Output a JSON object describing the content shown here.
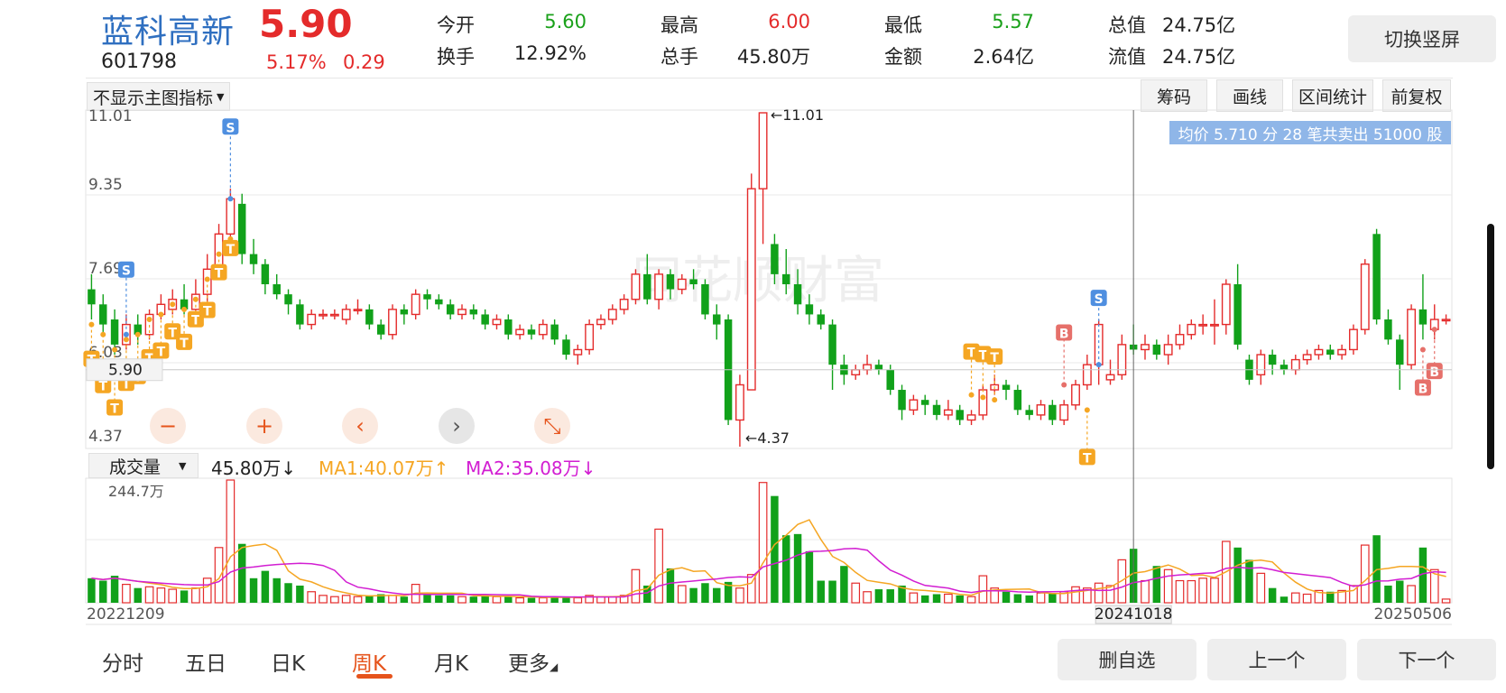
{
  "header": {
    "name": "蓝科高新",
    "price": "5.90",
    "code": "601798",
    "change_pct": "5.17%",
    "change": "0.29",
    "quotes": [
      {
        "label": "今开",
        "value": "5.60",
        "color": "green"
      },
      {
        "label": "最高",
        "value": "6.00",
        "color": "red"
      },
      {
        "label": "最低",
        "value": "5.57",
        "color": "green"
      },
      {
        "label": "总值",
        "value": "24.75亿",
        "color": "dark"
      },
      {
        "label": "换手",
        "value": "12.92%",
        "color": "dark"
      },
      {
        "label": "总手",
        "value": "45.80万",
        "color": "dark"
      },
      {
        "label": "金额",
        "value": "2.64亿",
        "color": "dark"
      },
      {
        "label": "流值",
        "value": "24.75亿",
        "color": "dark"
      }
    ],
    "rotate_button": "切换竖屏"
  },
  "toolbar": {
    "indicator_select": "不显示主图指标",
    "buttons": [
      "筹码",
      "画线",
      "区间统计",
      "前复权"
    ]
  },
  "main_chart": {
    "y_labels": [
      "11.01",
      "9.35",
      "7.69",
      "6.03",
      "4.37"
    ],
    "current_price_label": "5.90",
    "high_marker": "11.01",
    "low_marker": "4.37",
    "watermark": "同花顺财富",
    "tooltip": "均价 5.710 分 28 笔共卖出 51000 股",
    "controls": [
      "zoom-out",
      "zoom-in",
      "pan-left",
      "pan-right",
      "collapse"
    ]
  },
  "volume": {
    "select_label": "成交量",
    "value": "45.80万↓",
    "ma1": "MA1:40.07万↑",
    "ma2": "MA2:35.08万↓",
    "max_label": "244.7万",
    "date_start": "20221209",
    "date_cursor": "20241018",
    "date_end": "20250506"
  },
  "nav": {
    "tabs": [
      "分时",
      "五日",
      "日K",
      "周K",
      "月K",
      "更多"
    ],
    "active": "周K",
    "buttons": [
      "删自选",
      "上一个",
      "下一个"
    ]
  },
  "colors": {
    "up": "#e42b2b",
    "down": "#11a11a",
    "ma1": "#f5a623",
    "ma2": "#d21ed2",
    "accent": "#e6541c",
    "signal": "#f5a623",
    "sell_signal": "#4f8fe0",
    "buy_signal": "#e6706a"
  },
  "chart_data": {
    "type": "candlestick",
    "y_range": [
      4.37,
      11.01
    ],
    "weeks": [
      {
        "o": 7.5,
        "c": 7.2,
        "h": 7.8,
        "l": 6.9,
        "v": 0.2
      },
      {
        "o": 7.2,
        "c": 6.8,
        "h": 7.4,
        "l": 6.6,
        "v": 0.18
      },
      {
        "o": 6.9,
        "c": 6.4,
        "h": 7.1,
        "l": 6.2,
        "v": 0.22
      },
      {
        "o": 6.4,
        "c": 6.8,
        "h": 7.0,
        "l": 6.3,
        "v": 0.15
      },
      {
        "o": 6.8,
        "c": 6.6,
        "h": 7.0,
        "l": 6.4,
        "v": 0.12
      },
      {
        "o": 6.6,
        "c": 7.0,
        "h": 7.1,
        "l": 6.5,
        "v": 0.13
      },
      {
        "o": 7.0,
        "c": 7.2,
        "h": 7.4,
        "l": 6.9,
        "v": 0.12
      },
      {
        "o": 7.1,
        "c": 7.3,
        "h": 7.5,
        "l": 7.0,
        "v": 0.11
      },
      {
        "o": 7.3,
        "c": 7.1,
        "h": 7.6,
        "l": 7.0,
        "v": 0.1
      },
      {
        "o": 7.1,
        "c": 7.4,
        "h": 7.7,
        "l": 7.0,
        "v": 0.12
      },
      {
        "o": 7.4,
        "c": 7.9,
        "h": 8.2,
        "l": 7.2,
        "v": 0.2
      },
      {
        "o": 7.9,
        "c": 8.6,
        "h": 8.8,
        "l": 7.7,
        "v": 0.45
      },
      {
        "o": 8.6,
        "c": 9.3,
        "h": 9.5,
        "l": 8.3,
        "v": 1.0
      },
      {
        "o": 9.2,
        "c": 8.2,
        "h": 9.4,
        "l": 8.0,
        "v": 0.48
      },
      {
        "o": 8.2,
        "c": 8.0,
        "h": 8.5,
        "l": 7.8,
        "v": 0.2
      },
      {
        "o": 8.0,
        "c": 7.6,
        "h": 8.1,
        "l": 7.4,
        "v": 0.26
      },
      {
        "o": 7.6,
        "c": 7.4,
        "h": 7.8,
        "l": 7.3,
        "v": 0.2
      },
      {
        "o": 7.4,
        "c": 7.2,
        "h": 7.5,
        "l": 7.0,
        "v": 0.16
      },
      {
        "o": 7.2,
        "c": 6.8,
        "h": 7.3,
        "l": 6.7,
        "v": 0.14
      },
      {
        "o": 6.8,
        "c": 7.0,
        "h": 7.1,
        "l": 6.7,
        "v": 0.09
      },
      {
        "o": 7.0,
        "c": 7.0,
        "h": 7.1,
        "l": 6.9,
        "v": 0.06
      },
      {
        "o": 7.0,
        "c": 7.0,
        "h": 7.1,
        "l": 6.9,
        "v": 0.05
      },
      {
        "o": 6.9,
        "c": 7.1,
        "h": 7.2,
        "l": 6.8,
        "v": 0.06
      },
      {
        "o": 7.1,
        "c": 7.1,
        "h": 7.3,
        "l": 7.0,
        "v": 0.05
      },
      {
        "o": 7.1,
        "c": 6.8,
        "h": 7.2,
        "l": 6.7,
        "v": 0.06
      },
      {
        "o": 6.8,
        "c": 6.6,
        "h": 6.9,
        "l": 6.5,
        "v": 0.07
      },
      {
        "o": 6.6,
        "c": 7.1,
        "h": 7.2,
        "l": 6.5,
        "v": 0.06
      },
      {
        "o": 7.1,
        "c": 7.0,
        "h": 7.2,
        "l": 6.8,
        "v": 0.05
      },
      {
        "o": 7.0,
        "c": 7.4,
        "h": 7.5,
        "l": 6.9,
        "v": 0.15
      },
      {
        "o": 7.4,
        "c": 7.3,
        "h": 7.5,
        "l": 7.1,
        "v": 0.07
      },
      {
        "o": 7.3,
        "c": 7.2,
        "h": 7.4,
        "l": 7.1,
        "v": 0.06
      },
      {
        "o": 7.2,
        "c": 7.0,
        "h": 7.3,
        "l": 6.9,
        "v": 0.06
      },
      {
        "o": 7.0,
        "c": 7.1,
        "h": 7.2,
        "l": 6.9,
        "v": 0.05
      },
      {
        "o": 7.1,
        "c": 7.0,
        "h": 7.2,
        "l": 6.9,
        "v": 0.05
      },
      {
        "o": 7.0,
        "c": 6.8,
        "h": 7.1,
        "l": 6.7,
        "v": 0.06
      },
      {
        "o": 6.8,
        "c": 6.9,
        "h": 7.0,
        "l": 6.7,
        "v": 0.05
      },
      {
        "o": 6.9,
        "c": 6.6,
        "h": 7.0,
        "l": 6.5,
        "v": 0.05
      },
      {
        "o": 6.6,
        "c": 6.7,
        "h": 6.8,
        "l": 6.5,
        "v": 0.04
      },
      {
        "o": 6.7,
        "c": 6.6,
        "h": 6.8,
        "l": 6.5,
        "v": 0.04
      },
      {
        "o": 6.6,
        "c": 6.8,
        "h": 6.9,
        "l": 6.5,
        "v": 0.04
      },
      {
        "o": 6.8,
        "c": 6.5,
        "h": 6.9,
        "l": 6.4,
        "v": 0.05
      },
      {
        "o": 6.5,
        "c": 6.2,
        "h": 6.6,
        "l": 6.1,
        "v": 0.05
      },
      {
        "o": 6.2,
        "c": 6.3,
        "h": 6.4,
        "l": 6.0,
        "v": 0.04
      },
      {
        "o": 6.3,
        "c": 6.8,
        "h": 6.9,
        "l": 6.2,
        "v": 0.06
      },
      {
        "o": 6.8,
        "c": 6.9,
        "h": 7.0,
        "l": 6.7,
        "v": 0.05
      },
      {
        "o": 6.9,
        "c": 7.1,
        "h": 7.2,
        "l": 6.8,
        "v": 0.05
      },
      {
        "o": 7.1,
        "c": 7.3,
        "h": 7.4,
        "l": 7.0,
        "v": 0.06
      },
      {
        "o": 7.3,
        "c": 7.8,
        "h": 7.9,
        "l": 7.2,
        "v": 0.27
      },
      {
        "o": 7.8,
        "c": 7.3,
        "h": 8.2,
        "l": 7.2,
        "v": 0.14
      },
      {
        "o": 7.3,
        "c": 7.8,
        "h": 7.9,
        "l": 7.1,
        "v": 0.6
      },
      {
        "o": 7.8,
        "c": 7.5,
        "h": 7.9,
        "l": 7.3,
        "v": 0.28
      },
      {
        "o": 7.5,
        "c": 7.7,
        "h": 7.8,
        "l": 7.4,
        "v": 0.14
      },
      {
        "o": 7.7,
        "c": 7.6,
        "h": 7.9,
        "l": 7.5,
        "v": 0.12
      },
      {
        "o": 7.6,
        "c": 7.0,
        "h": 7.7,
        "l": 6.9,
        "v": 0.16
      },
      {
        "o": 7.0,
        "c": 6.8,
        "h": 7.2,
        "l": 6.5,
        "v": 0.12
      },
      {
        "o": 6.9,
        "c": 4.9,
        "h": 7.0,
        "l": 4.8,
        "v": 0.17
      },
      {
        "o": 4.9,
        "c": 5.6,
        "h": 5.8,
        "l": 4.37,
        "v": 0.12
      },
      {
        "o": 5.5,
        "c": 9.5,
        "h": 9.8,
        "l": 5.5,
        "v": 0.23
      },
      {
        "o": 9.5,
        "c": 11.01,
        "h": 11.01,
        "l": 8.4,
        "v": 0.98
      },
      {
        "o": 8.4,
        "c": 7.8,
        "h": 8.6,
        "l": 7.6,
        "v": 0.87
      },
      {
        "o": 7.8,
        "c": 7.6,
        "h": 8.3,
        "l": 7.4,
        "v": 0.55
      },
      {
        "o": 7.6,
        "c": 7.2,
        "h": 7.9,
        "l": 7.0,
        "v": 0.56
      },
      {
        "o": 7.2,
        "c": 7.0,
        "h": 7.4,
        "l": 6.8,
        "v": 0.42
      },
      {
        "o": 7.0,
        "c": 6.8,
        "h": 7.1,
        "l": 6.7,
        "v": 0.18
      },
      {
        "o": 6.8,
        "c": 6.0,
        "h": 6.9,
        "l": 5.5,
        "v": 0.18
      },
      {
        "o": 6.0,
        "c": 5.8,
        "h": 6.2,
        "l": 5.6,
        "v": 0.3
      },
      {
        "o": 5.8,
        "c": 5.9,
        "h": 6.0,
        "l": 5.7,
        "v": 0.16
      },
      {
        "o": 5.9,
        "c": 6.0,
        "h": 6.2,
        "l": 5.8,
        "v": 0.09
      },
      {
        "o": 6.0,
        "c": 5.9,
        "h": 6.1,
        "l": 5.8,
        "v": 0.11
      },
      {
        "o": 5.9,
        "c": 5.5,
        "h": 6.0,
        "l": 5.4,
        "v": 0.11
      },
      {
        "o": 5.5,
        "c": 5.1,
        "h": 5.6,
        "l": 4.9,
        "v": 0.14
      },
      {
        "o": 5.1,
        "c": 5.3,
        "h": 5.4,
        "l": 5.0,
        "v": 0.08
      },
      {
        "o": 5.3,
        "c": 5.2,
        "h": 5.4,
        "l": 5.0,
        "v": 0.06
      },
      {
        "o": 5.2,
        "c": 5.0,
        "h": 5.3,
        "l": 4.9,
        "v": 0.07
      },
      {
        "o": 5.0,
        "c": 5.1,
        "h": 5.3,
        "l": 4.9,
        "v": 0.07
      },
      {
        "o": 5.1,
        "c": 4.9,
        "h": 5.2,
        "l": 4.8,
        "v": 0.06
      },
      {
        "o": 4.9,
        "c": 5.0,
        "h": 5.1,
        "l": 4.8,
        "v": 0.05
      },
      {
        "o": 5.0,
        "c": 5.5,
        "h": 5.6,
        "l": 4.9,
        "v": 0.22
      },
      {
        "o": 5.5,
        "c": 5.6,
        "h": 5.8,
        "l": 5.4,
        "v": 0.12
      },
      {
        "o": 5.6,
        "c": 5.5,
        "h": 5.7,
        "l": 5.3,
        "v": 0.09
      },
      {
        "o": 5.5,
        "c": 5.1,
        "h": 5.6,
        "l": 5.0,
        "v": 0.07
      },
      {
        "o": 5.1,
        "c": 5.0,
        "h": 5.2,
        "l": 4.9,
        "v": 0.06
      },
      {
        "o": 5.0,
        "c": 5.2,
        "h": 5.3,
        "l": 4.9,
        "v": 0.08
      },
      {
        "o": 5.2,
        "c": 4.9,
        "h": 5.3,
        "l": 4.8,
        "v": 0.08
      },
      {
        "o": 4.9,
        "c": 5.2,
        "h": 5.3,
        "l": 4.8,
        "v": 0.09
      },
      {
        "o": 5.2,
        "c": 5.6,
        "h": 5.7,
        "l": 5.1,
        "v": 0.13
      },
      {
        "o": 5.6,
        "c": 6.0,
        "h": 6.2,
        "l": 5.5,
        "v": 0.12
      },
      {
        "o": 6.0,
        "c": 6.8,
        "h": 6.9,
        "l": 5.6,
        "v": 0.16
      },
      {
        "o": 5.7,
        "c": 5.8,
        "h": 6.1,
        "l": 5.6,
        "v": 0.14
      },
      {
        "o": 5.8,
        "c": 6.4,
        "h": 6.6,
        "l": 5.7,
        "v": 0.35
      },
      {
        "o": 6.4,
        "c": 6.3,
        "h": 6.8,
        "l": 6.2,
        "v": 0.44
      },
      {
        "o": 6.3,
        "c": 6.4,
        "h": 6.6,
        "l": 6.1,
        "v": 0.18
      },
      {
        "o": 6.4,
        "c": 6.2,
        "h": 6.5,
        "l": 6.1,
        "v": 0.3
      },
      {
        "o": 6.2,
        "c": 6.4,
        "h": 6.6,
        "l": 6.0,
        "v": 0.27
      },
      {
        "o": 6.4,
        "c": 6.6,
        "h": 6.8,
        "l": 6.3,
        "v": 0.18
      },
      {
        "o": 6.6,
        "c": 6.8,
        "h": 6.9,
        "l": 6.5,
        "v": 0.18
      },
      {
        "o": 6.8,
        "c": 6.8,
        "h": 7.0,
        "l": 6.6,
        "v": 0.2
      },
      {
        "o": 6.8,
        "c": 6.8,
        "h": 7.3,
        "l": 6.4,
        "v": 0.2
      },
      {
        "o": 6.8,
        "c": 7.6,
        "h": 7.7,
        "l": 6.6,
        "v": 0.5
      },
      {
        "o": 7.6,
        "c": 6.4,
        "h": 8.0,
        "l": 6.3,
        "v": 0.45
      },
      {
        "o": 6.1,
        "c": 5.7,
        "h": 6.2,
        "l": 5.6,
        "v": 0.35
      },
      {
        "o": 5.8,
        "c": 6.2,
        "h": 6.3,
        "l": 5.6,
        "v": 0.24
      },
      {
        "o": 6.2,
        "c": 6.0,
        "h": 6.3,
        "l": 5.8,
        "v": 0.12
      },
      {
        "o": 6.0,
        "c": 5.9,
        "h": 6.1,
        "l": 5.8,
        "v": 0.05
      },
      {
        "o": 5.9,
        "c": 6.1,
        "h": 6.2,
        "l": 5.8,
        "v": 0.08
      },
      {
        "o": 6.1,
        "c": 6.2,
        "h": 6.3,
        "l": 6.0,
        "v": 0.07
      },
      {
        "o": 6.2,
        "c": 6.3,
        "h": 6.4,
        "l": 6.1,
        "v": 0.1
      },
      {
        "o": 6.3,
        "c": 6.2,
        "h": 6.4,
        "l": 6.1,
        "v": 0.09
      },
      {
        "o": 6.2,
        "c": 6.3,
        "h": 6.4,
        "l": 6.1,
        "v": 0.1
      },
      {
        "o": 6.3,
        "c": 6.7,
        "h": 6.8,
        "l": 6.2,
        "v": 0.14
      },
      {
        "o": 6.7,
        "c": 8.0,
        "h": 8.1,
        "l": 6.6,
        "v": 0.47
      },
      {
        "o": 8.6,
        "c": 6.9,
        "h": 8.7,
        "l": 6.8,
        "v": 0.55
      },
      {
        "o": 6.9,
        "c": 6.5,
        "h": 7.1,
        "l": 6.4,
        "v": 0.14
      },
      {
        "o": 6.5,
        "c": 6.0,
        "h": 6.6,
        "l": 5.5,
        "v": 0.18
      },
      {
        "o": 6.0,
        "c": 7.1,
        "h": 7.2,
        "l": 5.9,
        "v": 0.14
      },
      {
        "o": 7.1,
        "c": 6.8,
        "h": 7.8,
        "l": 6.5,
        "v": 0.45
      },
      {
        "o": 6.7,
        "c": 6.9,
        "h": 7.2,
        "l": 6.5,
        "v": 0.27
      },
      {
        "o": 6.9,
        "c": 6.9,
        "h": 7.0,
        "l": 6.8,
        "v": 0.03
      }
    ]
  }
}
